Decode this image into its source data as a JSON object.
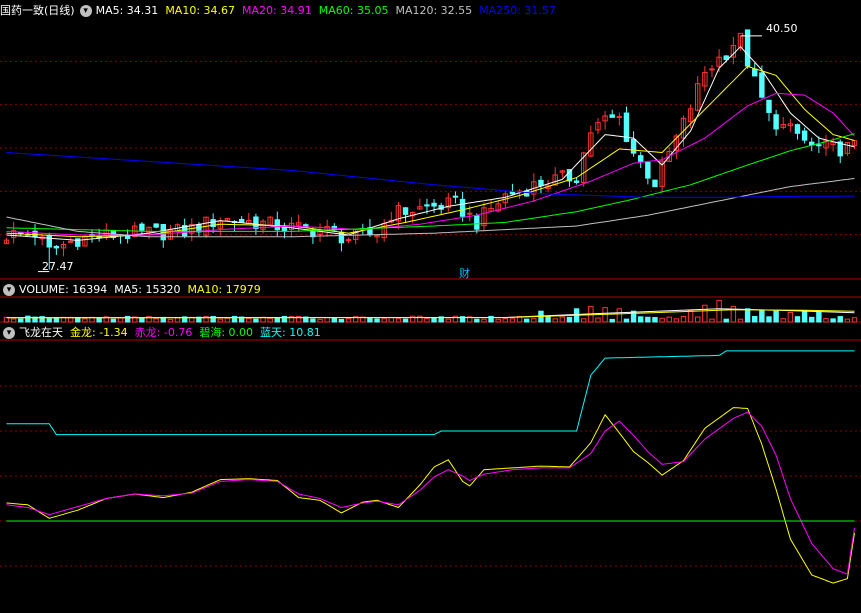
{
  "header_main": {
    "title": "国药一致(日线)",
    "icon": "chevron-down-icon",
    "ma": [
      {
        "label": "MA5: 34.31",
        "color": "#ffffff"
      },
      {
        "label": "MA10: 34.67",
        "color": "#ffff00"
      },
      {
        "label": "MA20: 34.91",
        "color": "#ff00ff"
      },
      {
        "label": "MA60: 35.05",
        "color": "#00ff00"
      },
      {
        "label": "MA120: 32.55",
        "color": "#c0c0c0"
      },
      {
        "label": "MA250: 31.57",
        "color": "#0000ff"
      }
    ]
  },
  "header_volume": {
    "title": "VOLUME: 16394",
    "icon": "chevron-down-icon",
    "ma": [
      {
        "label": "MA5: 15320",
        "color": "#ffffff"
      },
      {
        "label": "MA10: 17979",
        "color": "#ffff00"
      }
    ]
  },
  "header_indicator": {
    "title": "飞龙在天",
    "icon": "chevron-down-icon",
    "lines": [
      {
        "label": "金龙: -1.34",
        "color": "#ffff00"
      },
      {
        "label": "赤龙: -0.76",
        "color": "#ff00ff"
      },
      {
        "label": "碧海: 0.00",
        "color": "#00ff00"
      },
      {
        "label": "蓝天: 10.81",
        "color": "#00ffff"
      }
    ]
  },
  "annotations": {
    "high_label": "40.50",
    "low_label": "27.47",
    "finance_marker": "财"
  },
  "colors": {
    "up": "#ff3232",
    "down": "#54ffff",
    "grid": "#8b0000",
    "border": "#b00000"
  },
  "chart_data": [
    {
      "type": "candlestick",
      "x_count": 120,
      "ylim": [
        27.0,
        41.5
      ],
      "high": 40.5,
      "low": 27.47,
      "anchors": [
        [
          0,
          29.4
        ],
        [
          4,
          29.5
        ],
        [
          6,
          28.5
        ],
        [
          10,
          29.2
        ],
        [
          15,
          29.4
        ],
        [
          20,
          29.5
        ],
        [
          25,
          29.6
        ],
        [
          30,
          30.3
        ],
        [
          35,
          30.1
        ],
        [
          40,
          29.8
        ],
        [
          45,
          29.6
        ],
        [
          48,
          29.2
        ],
        [
          52,
          29.5
        ],
        [
          54,
          30.6
        ],
        [
          60,
          31.0
        ],
        [
          63,
          31.1
        ],
        [
          66,
          30.1
        ],
        [
          70,
          31.6
        ],
        [
          75,
          32.3
        ],
        [
          80,
          32.7
        ],
        [
          82,
          35.2
        ],
        [
          84,
          35.8
        ],
        [
          86,
          35.9
        ],
        [
          88,
          34.0
        ],
        [
          91,
          32.3
        ],
        [
          95,
          35.6
        ],
        [
          98,
          38.5
        ],
        [
          101,
          39.6
        ],
        [
          102,
          40.1
        ],
        [
          103,
          40.3
        ],
        [
          105,
          37.9
        ],
        [
          107,
          36.0
        ],
        [
          109,
          35.4
        ],
        [
          111,
          35.0
        ],
        [
          113,
          34.3
        ],
        [
          116,
          34.2
        ],
        [
          119,
          34.3
        ]
      ],
      "series": [
        {
          "name": "MA5",
          "color": "#ffffff",
          "line": [
            [
              0,
              29.4
            ],
            [
              10,
              29.1
            ],
            [
              20,
              29.5
            ],
            [
              30,
              30.2
            ],
            [
              40,
              29.8
            ],
            [
              48,
              29.4
            ],
            [
              55,
              30.3
            ],
            [
              62,
              31.0
            ],
            [
              70,
              31.5
            ],
            [
              78,
              32.5
            ],
            [
              84,
              35.0
            ],
            [
              88,
              34.8
            ],
            [
              92,
              33.3
            ],
            [
              96,
              35.2
            ],
            [
              100,
              38.7
            ],
            [
              103,
              39.9
            ],
            [
              106,
              38.6
            ],
            [
              110,
              36.2
            ],
            [
              114,
              34.8
            ],
            [
              119,
              34.31
            ]
          ]
        },
        {
          "name": "MA10",
          "color": "#ffff00",
          "line": [
            [
              0,
              29.5
            ],
            [
              10,
              29.3
            ],
            [
              20,
              29.4
            ],
            [
              30,
              30.0
            ],
            [
              40,
              29.9
            ],
            [
              48,
              29.5
            ],
            [
              56,
              30.1
            ],
            [
              64,
              30.8
            ],
            [
              72,
              31.6
            ],
            [
              80,
              32.6
            ],
            [
              86,
              34.2
            ],
            [
              92,
              34.0
            ],
            [
              98,
              36.4
            ],
            [
              104,
              38.8
            ],
            [
              108,
              38.3
            ],
            [
              112,
              36.4
            ],
            [
              116,
              35.0
            ],
            [
              119,
              34.67
            ]
          ]
        },
        {
          "name": "MA20",
          "color": "#ff00ff",
          "line": [
            [
              0,
              29.6
            ],
            [
              10,
              29.4
            ],
            [
              20,
              29.4
            ],
            [
              30,
              29.7
            ],
            [
              40,
              29.9
            ],
            [
              50,
              29.7
            ],
            [
              58,
              30.0
            ],
            [
              66,
              30.5
            ],
            [
              74,
              31.3
            ],
            [
              82,
              32.4
            ],
            [
              88,
              33.4
            ],
            [
              92,
              33.6
            ],
            [
              98,
              34.8
            ],
            [
              104,
              36.6
            ],
            [
              108,
              37.3
            ],
            [
              112,
              37.2
            ],
            [
              116,
              36.2
            ],
            [
              119,
              34.91
            ]
          ]
        },
        {
          "name": "MA60",
          "color": "#00ff00",
          "line": [
            [
              0,
              29.8
            ],
            [
              20,
              29.6
            ],
            [
              40,
              29.6
            ],
            [
              60,
              29.9
            ],
            [
              70,
              30.1
            ],
            [
              80,
              30.7
            ],
            [
              88,
              31.4
            ],
            [
              96,
              32.2
            ],
            [
              104,
              33.3
            ],
            [
              110,
              34.1
            ],
            [
              115,
              34.6
            ],
            [
              119,
              35.05
            ]
          ]
        },
        {
          "name": "MA120",
          "color": "#c0c0c0",
          "line": [
            [
              0,
              30.4
            ],
            [
              10,
              29.6
            ],
            [
              20,
              29.3
            ],
            [
              40,
              29.3
            ],
            [
              60,
              29.5
            ],
            [
              80,
              29.9
            ],
            [
              90,
              30.5
            ],
            [
              100,
              31.3
            ],
            [
              110,
              32.1
            ],
            [
              119,
              32.55
            ]
          ]
        },
        {
          "name": "MA250",
          "color": "#0000ff",
          "line": [
            [
              0,
              34.0
            ],
            [
              20,
              33.5
            ],
            [
              40,
              33.0
            ],
            [
              60,
              32.2
            ],
            [
              75,
              31.7
            ],
            [
              90,
              31.5
            ],
            [
              100,
              31.5
            ],
            [
              110,
              31.55
            ],
            [
              119,
              31.57
            ]
          ]
        }
      ]
    },
    {
      "type": "bar",
      "name": "VOLUME",
      "ylim": [
        0,
        40000
      ],
      "last": 16394,
      "ma5": 15320,
      "ma10": 17979,
      "base_volume": 7000,
      "spikes": [
        [
          75,
          18000
        ],
        [
          80,
          22000
        ],
        [
          82,
          26000
        ],
        [
          84,
          24000
        ],
        [
          86,
          22000
        ],
        [
          88,
          18000
        ],
        [
          96,
          19000
        ],
        [
          98,
          28000
        ],
        [
          100,
          36000
        ],
        [
          102,
          26000
        ],
        [
          104,
          22000
        ],
        [
          106,
          20000
        ],
        [
          108,
          18000
        ],
        [
          110,
          16000
        ],
        [
          112,
          18000
        ],
        [
          114,
          16394
        ]
      ]
    },
    {
      "type": "line",
      "name": "飞龙在天",
      "ylim": [
        -10,
        20
      ],
      "series": [
        {
          "name": "金龙",
          "color": "#ffff00",
          "line": [
            [
              0,
              2.0
            ],
            [
              3,
              1.8
            ],
            [
              6,
              0.3
            ],
            [
              10,
              1.2
            ],
            [
              14,
              2.5
            ],
            [
              18,
              3.0
            ],
            [
              22,
              2.6
            ],
            [
              26,
              3.2
            ],
            [
              30,
              4.6
            ],
            [
              34,
              4.7
            ],
            [
              38,
              4.5
            ],
            [
              41,
              2.6
            ],
            [
              44,
              2.3
            ],
            [
              47,
              0.9
            ],
            [
              50,
              2.1
            ],
            [
              52,
              2.3
            ],
            [
              55,
              1.5
            ],
            [
              58,
              4.0
            ],
            [
              60,
              6.0
            ],
            [
              62,
              6.8
            ],
            [
              64,
              4.4
            ],
            [
              65,
              3.9
            ],
            [
              67,
              5.7
            ],
            [
              71,
              5.9
            ],
            [
              75,
              6.1
            ],
            [
              79,
              6.0
            ],
            [
              82,
              8.7
            ],
            [
              84,
              11.8
            ],
            [
              86,
              9.8
            ],
            [
              88,
              7.7
            ],
            [
              90,
              6.5
            ],
            [
              92,
              5.1
            ],
            [
              95,
              6.7
            ],
            [
              98,
              10.3
            ],
            [
              102,
              12.6
            ],
            [
              104,
              12.5
            ],
            [
              106,
              8.5
            ],
            [
              108,
              3.5
            ],
            [
              110,
              -2.0
            ],
            [
              113,
              -6.0
            ],
            [
              116,
              -6.9
            ],
            [
              118,
              -6.4
            ],
            [
              119,
              -1.34
            ]
          ]
        },
        {
          "name": "赤龙",
          "color": "#ff00ff",
          "line": [
            [
              0,
              1.8
            ],
            [
              3,
              1.5
            ],
            [
              6,
              0.7
            ],
            [
              10,
              1.6
            ],
            [
              14,
              2.5
            ],
            [
              18,
              3.0
            ],
            [
              22,
              2.8
            ],
            [
              26,
              3.1
            ],
            [
              30,
              4.4
            ],
            [
              34,
              4.6
            ],
            [
              38,
              4.4
            ],
            [
              41,
              3.0
            ],
            [
              44,
              2.5
            ],
            [
              47,
              1.5
            ],
            [
              50,
              2.0
            ],
            [
              52,
              2.2
            ],
            [
              55,
              1.8
            ],
            [
              58,
              3.4
            ],
            [
              60,
              4.9
            ],
            [
              62,
              5.7
            ],
            [
              64,
              5.0
            ],
            [
              65,
              4.5
            ],
            [
              67,
              5.2
            ],
            [
              71,
              5.7
            ],
            [
              75,
              5.9
            ],
            [
              79,
              5.9
            ],
            [
              82,
              7.5
            ],
            [
              84,
              10.0
            ],
            [
              86,
              11.1
            ],
            [
              88,
              9.5
            ],
            [
              90,
              7.7
            ],
            [
              92,
              6.3
            ],
            [
              95,
              6.6
            ],
            [
              98,
              9.1
            ],
            [
              102,
              11.4
            ],
            [
              104,
              12.1
            ],
            [
              106,
              10.5
            ],
            [
              108,
              7.3
            ],
            [
              110,
              2.5
            ],
            [
              113,
              -2.5
            ],
            [
              116,
              -5.3
            ],
            [
              118,
              -5.9
            ],
            [
              119,
              -0.76
            ]
          ]
        },
        {
          "name": "碧海",
          "color": "#00ff00",
          "line": [
            [
              0,
              0
            ],
            [
              119,
              0
            ]
          ]
        },
        {
          "name": "蓝天",
          "color": "#00ffff",
          "line": [
            [
              0,
              10.8
            ],
            [
              6,
              10.8
            ],
            [
              7,
              9.6
            ],
            [
              60,
              9.6
            ],
            [
              61,
              10.0
            ],
            [
              80,
              10.0
            ],
            [
              82,
              16.2
            ],
            [
              84,
              18.1
            ],
            [
              100,
              18.4
            ],
            [
              101,
              18.9
            ],
            [
              119,
              18.9
            ]
          ]
        }
      ]
    }
  ]
}
